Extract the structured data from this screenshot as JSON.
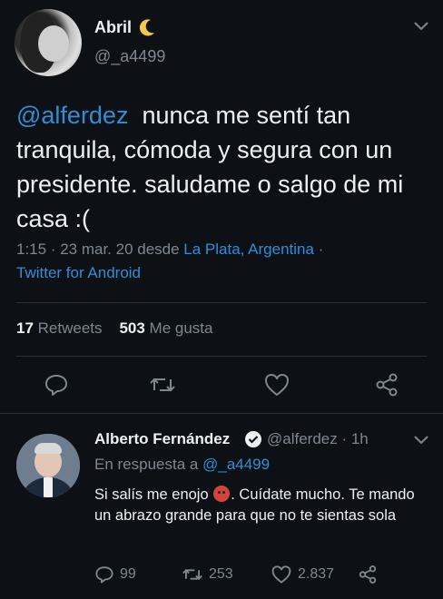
{
  "tweet": {
    "author_name": "Abril",
    "author_handle": "@_a4499",
    "mention": "@alferdez",
    "text": "nunca me sentí tan tranquila, cómoda y segura con un presidente. saludame o salgo de mi casa :(",
    "timestamp": "1:15 · 23 mar. 20 desde",
    "location": "La Plata, Argentina",
    "location_sep": "·",
    "source": "Twitter for Android",
    "retweets_count": "17",
    "retweets_label": "Retweets",
    "likes_count": "503",
    "likes_label": "Me gusta"
  },
  "reply": {
    "author_name": "Alberto Fernández",
    "author_handle": "@alferdez · 1h",
    "reply_to_label": "En respuesta a",
    "reply_to_handle": "@_a4499",
    "text_before": "Si salís me enojo",
    "text_after": ". Cuídate mucho. Te mando un abrazo grande para que no te sientas sola",
    "replies_count": "99",
    "retweets_count": "253",
    "likes_count": "2.837"
  },
  "colors": {
    "background": "#0d1015",
    "accent": "#2f8fd6",
    "muted": "#7e8791",
    "text": "#eef0f2"
  },
  "icons": [
    "moon-emoji-icon",
    "chevron-down-icon",
    "reply-icon",
    "retweet-icon",
    "like-icon",
    "share-icon",
    "verified-badge-icon",
    "angry-face-emoji-icon"
  ]
}
